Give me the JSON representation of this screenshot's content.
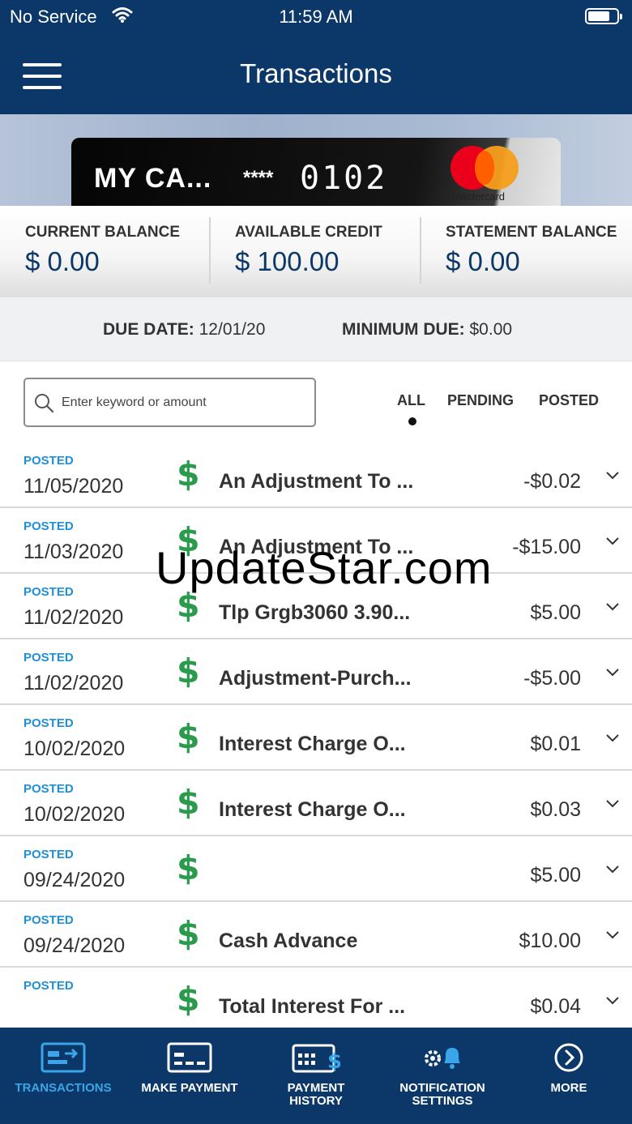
{
  "status_bar": {
    "carrier": "No Service",
    "time": "11:59 AM"
  },
  "header": {
    "title": "Transactions"
  },
  "card": {
    "name": "MY CA...",
    "mask": "****",
    "last4": "0102",
    "brand": "mastercard"
  },
  "balances": [
    {
      "label": "CURRENT BALANCE",
      "value": "$ 0.00"
    },
    {
      "label": "AVAILABLE CREDIT",
      "value": "$ 100.00"
    },
    {
      "label": "STATEMENT BALANCE",
      "value": "$ 0.00"
    }
  ],
  "due": {
    "due_date_label": "DUE DATE:",
    "due_date_value": "12/01/20",
    "min_due_label": "MINIMUM DUE:",
    "min_due_value": "$0.00"
  },
  "search": {
    "placeholder": "Enter keyword or amount"
  },
  "filters": {
    "all": "ALL",
    "pending": "PENDING",
    "posted": "POSTED",
    "selected": "ALL"
  },
  "transactions": [
    {
      "status": "POSTED",
      "date": "11/05/2020",
      "description": "An Adjustment To ...",
      "amount": "-$0.02"
    },
    {
      "status": "POSTED",
      "date": "11/03/2020",
      "description": "An Adjustment To ...",
      "amount": "-$15.00"
    },
    {
      "status": "POSTED",
      "date": "11/02/2020",
      "description": "Tlp Grgb3060 3.90...",
      "amount": "$5.00"
    },
    {
      "status": "POSTED",
      "date": "11/02/2020",
      "description": "Adjustment-Purch...",
      "amount": "-$5.00"
    },
    {
      "status": "POSTED",
      "date": "10/02/2020",
      "description": "Interest Charge O...",
      "amount": "$0.01"
    },
    {
      "status": "POSTED",
      "date": "10/02/2020",
      "description": "Interest Charge O...",
      "amount": "$0.03"
    },
    {
      "status": "POSTED",
      "date": "09/24/2020",
      "description": "",
      "amount": "$5.00"
    },
    {
      "status": "POSTED",
      "date": "09/24/2020",
      "description": "Cash Advance",
      "amount": "$10.00"
    },
    {
      "status": "POSTED",
      "date": "",
      "description": "Total Interest For ...",
      "amount": "$0.04"
    }
  ],
  "tx_icon": "$",
  "watermark": "UpdateStar.com",
  "tabs": [
    {
      "label": "TRANSACTIONS",
      "icon": "transactions-icon"
    },
    {
      "label": "MAKE PAYMENT",
      "icon": "card-payment-icon"
    },
    {
      "label": "PAYMENT HISTORY",
      "icon": "payment-history-icon"
    },
    {
      "label": "NOTIFICATION SETTINGS",
      "icon": "notification-settings-icon"
    },
    {
      "label": "MORE",
      "icon": "more-icon"
    }
  ],
  "colors": {
    "navy": "#0b3868",
    "accent": "#3aa5e8",
    "posted": "#1f8fd6",
    "dollar": "#2a9a4c"
  }
}
